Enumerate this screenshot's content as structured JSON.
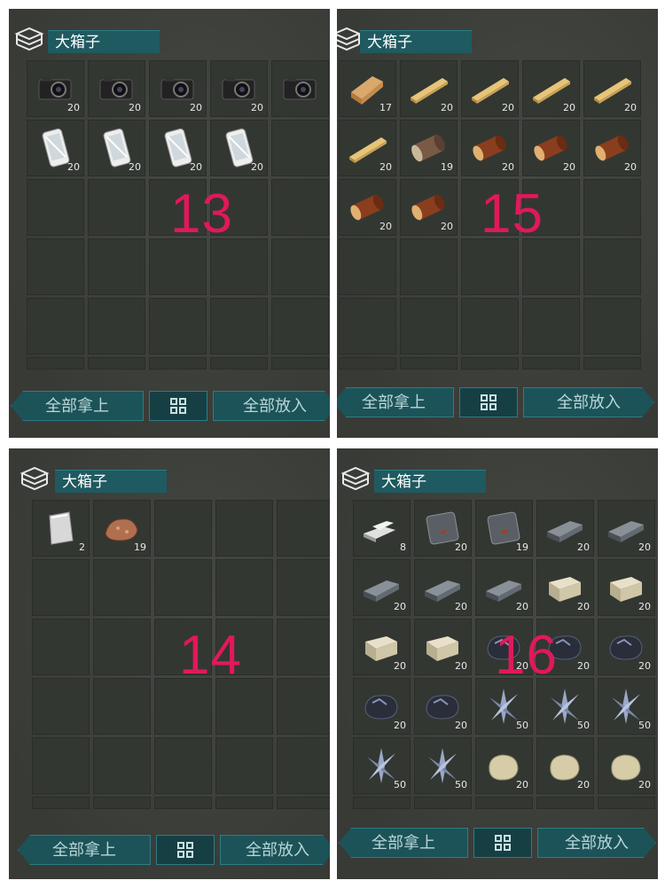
{
  "panels": [
    {
      "title": "大箱子",
      "label": "13",
      "take_all": "全部拿上",
      "put_all": "全部放入",
      "items": [
        {
          "icon": "camera-icon",
          "count": "20"
        },
        {
          "icon": "camera-icon",
          "count": "20"
        },
        {
          "icon": "camera-icon",
          "count": "20"
        },
        {
          "icon": "camera-icon",
          "count": "20"
        },
        {
          "icon": "camera-icon",
          "count": ""
        },
        {
          "icon": "phone-icon",
          "count": "20"
        },
        {
          "icon": "phone-icon",
          "count": "20"
        },
        {
          "icon": "phone-icon",
          "count": "20"
        },
        {
          "icon": "phone-icon",
          "count": "20"
        }
      ]
    },
    {
      "title": "大箱子",
      "label": "15",
      "take_all": "全部拿上",
      "put_all": "全部放入",
      "items": [
        {
          "icon": "wood-block-icon",
          "count": "17"
        },
        {
          "icon": "plank-icon",
          "count": "20"
        },
        {
          "icon": "plank-icon",
          "count": "20"
        },
        {
          "icon": "plank-icon",
          "count": "20"
        },
        {
          "icon": "plank-icon",
          "count": "20"
        },
        {
          "icon": "plank-icon",
          "count": "20"
        },
        {
          "icon": "log-gray-icon",
          "count": "19"
        },
        {
          "icon": "log-icon",
          "count": "20"
        },
        {
          "icon": "log-icon",
          "count": "20"
        },
        {
          "icon": "log-icon",
          "count": "20"
        },
        {
          "icon": "log-icon",
          "count": "20"
        },
        {
          "icon": "log-icon",
          "count": "20"
        }
      ]
    },
    {
      "title": "大箱子",
      "label": "14",
      "take_all": "全部拿上",
      "put_all": "全部放入",
      "items": [
        {
          "icon": "metal-sheet-icon",
          "count": "2"
        },
        {
          "icon": "copper-ore-icon",
          "count": "19"
        }
      ]
    },
    {
      "title": "大箱子",
      "label": "16",
      "take_all": "全部拿上",
      "put_all": "全部放入",
      "items": [
        {
          "icon": "silver-bars-icon",
          "count": "8"
        },
        {
          "icon": "iron-plate-icon",
          "count": "20"
        },
        {
          "icon": "iron-plate-icon",
          "count": "19"
        },
        {
          "icon": "iron-ingot-icon",
          "count": "20"
        },
        {
          "icon": "iron-ingot-icon",
          "count": "20"
        },
        {
          "icon": "iron-ingot-icon",
          "count": "20"
        },
        {
          "icon": "iron-ingot-icon",
          "count": "20"
        },
        {
          "icon": "iron-ingot-icon",
          "count": "20"
        },
        {
          "icon": "stone-block-icon",
          "count": "20"
        },
        {
          "icon": "stone-block-icon",
          "count": "20"
        },
        {
          "icon": "stone-block-icon",
          "count": "20"
        },
        {
          "icon": "stone-block-icon",
          "count": "20"
        },
        {
          "icon": "coal-ore-icon",
          "count": "20"
        },
        {
          "icon": "coal-ore-icon",
          "count": "20"
        },
        {
          "icon": "coal-ore-icon",
          "count": "20"
        },
        {
          "icon": "coal-ore-icon",
          "count": "20"
        },
        {
          "icon": "coal-ore-icon",
          "count": "20"
        },
        {
          "icon": "crystal-icon",
          "count": "50"
        },
        {
          "icon": "crystal-icon",
          "count": "50"
        },
        {
          "icon": "crystal-icon",
          "count": "50"
        },
        {
          "icon": "crystal-icon",
          "count": "50"
        },
        {
          "icon": "crystal-icon",
          "count": "50"
        },
        {
          "icon": "rock-icon",
          "count": "20"
        },
        {
          "icon": "rock-icon",
          "count": "20"
        },
        {
          "icon": "rock-icon",
          "count": "20"
        }
      ]
    }
  ]
}
